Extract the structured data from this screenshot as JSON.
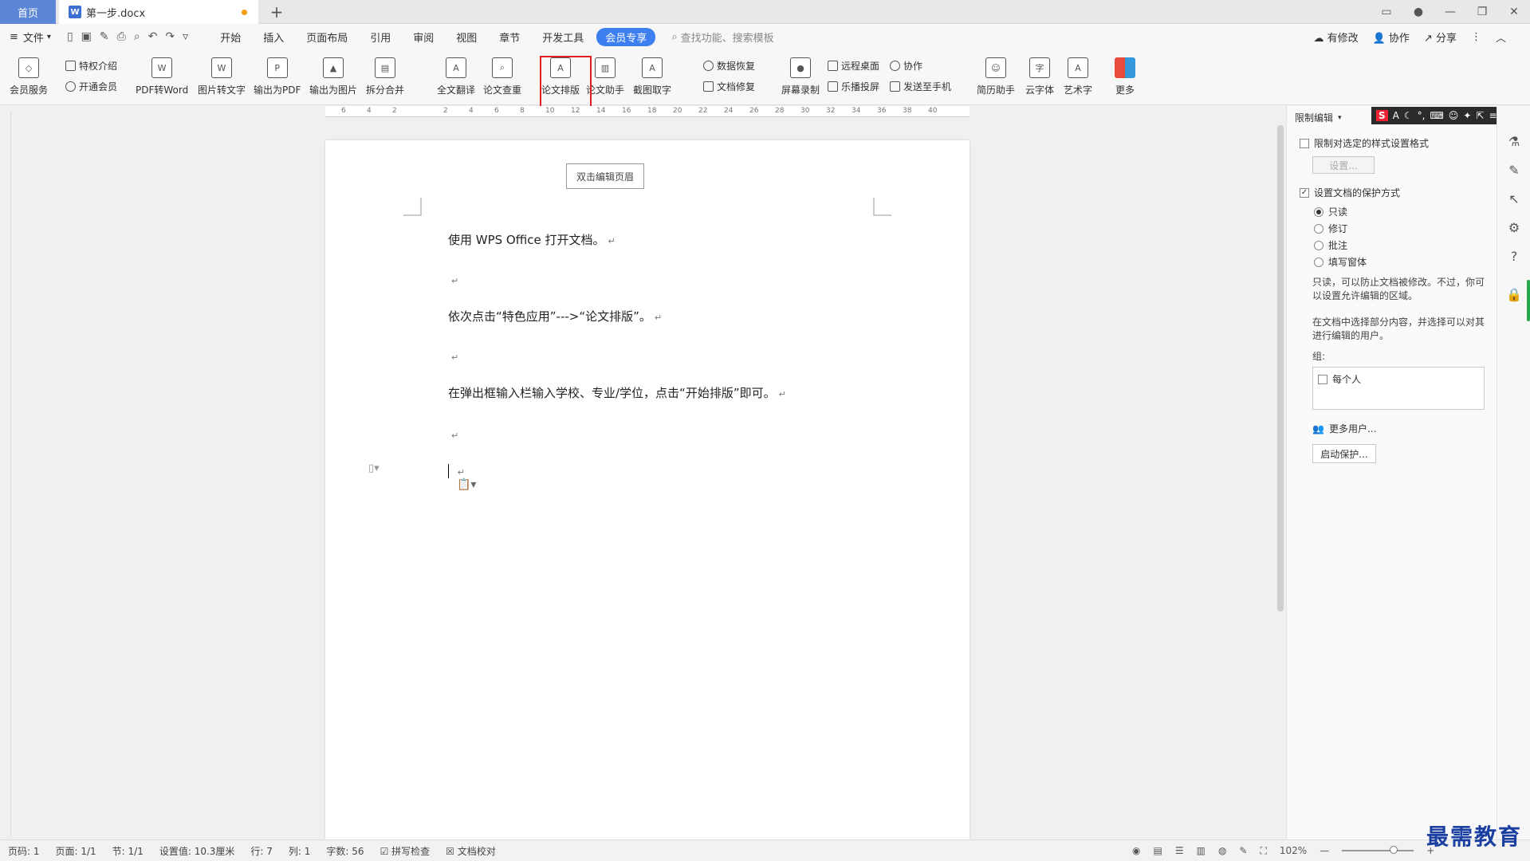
{
  "tabs": {
    "home": "首页",
    "doc": "第一步.docx"
  },
  "menubar": {
    "file": "文件",
    "menus": [
      "开始",
      "插入",
      "页面布局",
      "引用",
      "审阅",
      "视图",
      "章节",
      "开发工具"
    ],
    "vip": "会员专享",
    "search": "查找功能、搜索模板",
    "right": {
      "modify": "有修改",
      "collab": "协作",
      "share": "分享"
    }
  },
  "ribbon": {
    "member_service": "会员服务",
    "privilege": "特权介绍",
    "open_member": "开通会员",
    "pdf_to_word": "PDF转Word",
    "img_to_text": "图片转文字",
    "export_pdf": "输出为PDF",
    "export_img": "输出为图片",
    "split_merge": "拆分合并",
    "full_translate": "全文翻译",
    "paper_check": "论文查重",
    "paper_layout": "论文排版",
    "paper_assist": "论文助手",
    "screenshot_ocr": "截图取字",
    "data_recover": "数据恢复",
    "doc_repair": "文档修复",
    "screen_record": "屏幕录制",
    "remote_desktop": "远程桌面",
    "cast": "乐播投屏",
    "collab": "协作",
    "send_phone": "发送至手机",
    "resume": "简历助手",
    "cloud_font": "云字体",
    "art_text": "艺术字",
    "more": "更多"
  },
  "ruler": [
    "6",
    "4",
    "2",
    "2",
    "4",
    "6",
    "8",
    "10",
    "12",
    "14",
    "16",
    "18",
    "20",
    "22",
    "24",
    "26",
    "28",
    "30",
    "32",
    "34",
    "36",
    "38",
    "40"
  ],
  "document": {
    "header_button": "双击编辑页眉",
    "paragraphs": [
      "使用 WPS Office 打开文档。",
      "依次点击“特色应用”--->“论文排版”。",
      "在弹出框输入栏输入学校、专业/学位，点击“开始排版”即可。"
    ],
    "para_mark": "↵"
  },
  "panel": {
    "title": "限制编辑",
    "limit_style": "限制对选定的样式设置格式",
    "settings_btn": "设置...",
    "protect_mode": "设置文档的保护方式",
    "options": [
      "只读",
      "修订",
      "批注",
      "填写窗体"
    ],
    "desc1": "只读，可以防止文档被修改。不过，你可以设置允许编辑的区域。",
    "desc2": "在文档中选择部分内容，并选择可以对其进行编辑的用户。",
    "group_label": "组:",
    "everyone": "每个人",
    "more_users": "更多用户...",
    "start_protect": "启动保护..."
  },
  "statusbar": {
    "page_num": "页码: 1",
    "page": "页面: 1/1",
    "section": "节: 1/1",
    "setting": "设置值: 10.3厘米",
    "row": "行: 7",
    "col": "列: 1",
    "words": "字数: 56",
    "spell": "拼写检查",
    "proof": "文档校对",
    "zoom": "102%"
  },
  "watermark": "最需教育",
  "colors": {
    "accent": "#3d7ef0",
    "highlight": "#e02020",
    "home_tab": "#5b87d6"
  }
}
